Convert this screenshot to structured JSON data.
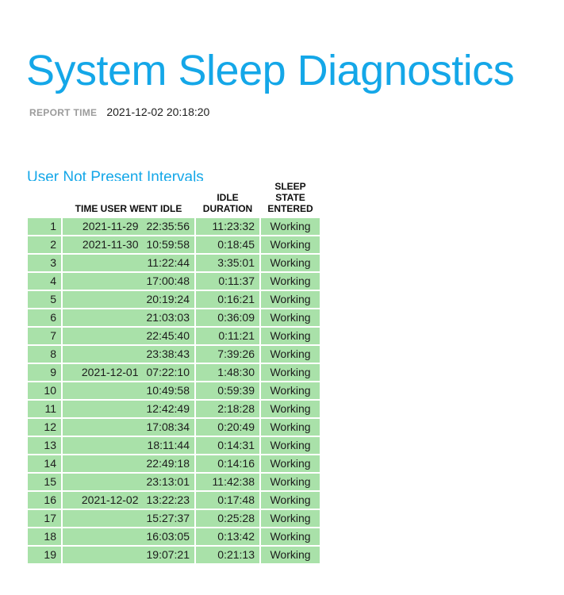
{
  "report": {
    "title": "System Sleep Diagnostics",
    "report_time_label": "REPORT TIME",
    "report_time_value": "2021-12-02 20:18:20",
    "accent_color": "#14A7E8",
    "row_color": "#A9E1A9",
    "label_color": "#9B9B9B"
  },
  "section": {
    "heading": "User Not Present Intervals"
  },
  "table": {
    "columns": {
      "index": "",
      "idle_time": "TIME USER WENT IDLE",
      "idle_duration": "IDLE DURATION",
      "sleep_state": "SLEEP STATE ENTERED"
    },
    "column_header_lines": {
      "idle_time": [
        "TIME USER WENT IDLE"
      ],
      "idle_duration": [
        "IDLE",
        "DURATION"
      ],
      "sleep_state": [
        "SLEEP",
        "STATE",
        "ENTERED"
      ]
    },
    "rows": [
      {
        "index": "1",
        "date": "2021-11-29",
        "time": "22:35:56",
        "idle_duration": "11:23:32",
        "sleep_state": "Working"
      },
      {
        "index": "2",
        "date": "2021-11-30",
        "time": "10:59:58",
        "idle_duration": "0:18:45",
        "sleep_state": "Working"
      },
      {
        "index": "3",
        "date": "",
        "time": "11:22:44",
        "idle_duration": "3:35:01",
        "sleep_state": "Working"
      },
      {
        "index": "4",
        "date": "",
        "time": "17:00:48",
        "idle_duration": "0:11:37",
        "sleep_state": "Working"
      },
      {
        "index": "5",
        "date": "",
        "time": "20:19:24",
        "idle_duration": "0:16:21",
        "sleep_state": "Working"
      },
      {
        "index": "6",
        "date": "",
        "time": "21:03:03",
        "idle_duration": "0:36:09",
        "sleep_state": "Working"
      },
      {
        "index": "7",
        "date": "",
        "time": "22:45:40",
        "idle_duration": "0:11:21",
        "sleep_state": "Working"
      },
      {
        "index": "8",
        "date": "",
        "time": "23:38:43",
        "idle_duration": "7:39:26",
        "sleep_state": "Working"
      },
      {
        "index": "9",
        "date": "2021-12-01",
        "time": "07:22:10",
        "idle_duration": "1:48:30",
        "sleep_state": "Working"
      },
      {
        "index": "10",
        "date": "",
        "time": "10:49:58",
        "idle_duration": "0:59:39",
        "sleep_state": "Working"
      },
      {
        "index": "11",
        "date": "",
        "time": "12:42:49",
        "idle_duration": "2:18:28",
        "sleep_state": "Working"
      },
      {
        "index": "12",
        "date": "",
        "time": "17:08:34",
        "idle_duration": "0:20:49",
        "sleep_state": "Working"
      },
      {
        "index": "13",
        "date": "",
        "time": "18:11:44",
        "idle_duration": "0:14:31",
        "sleep_state": "Working"
      },
      {
        "index": "14",
        "date": "",
        "time": "22:49:18",
        "idle_duration": "0:14:16",
        "sleep_state": "Working"
      },
      {
        "index": "15",
        "date": "",
        "time": "23:13:01",
        "idle_duration": "11:42:38",
        "sleep_state": "Working"
      },
      {
        "index": "16",
        "date": "2021-12-02",
        "time": "13:22:23",
        "idle_duration": "0:17:48",
        "sleep_state": "Working"
      },
      {
        "index": "17",
        "date": "",
        "time": "15:27:37",
        "idle_duration": "0:25:28",
        "sleep_state": "Working"
      },
      {
        "index": "18",
        "date": "",
        "time": "16:03:05",
        "idle_duration": "0:13:42",
        "sleep_state": "Working"
      },
      {
        "index": "19",
        "date": "",
        "time": "19:07:21",
        "idle_duration": "0:21:13",
        "sleep_state": "Working"
      }
    ]
  }
}
